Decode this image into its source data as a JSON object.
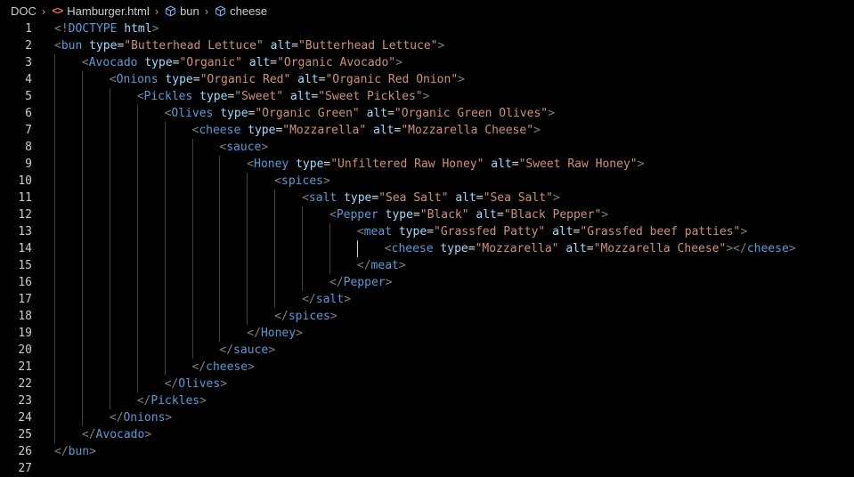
{
  "breadcrumb": [
    {
      "label": "DOC",
      "icon": null
    },
    {
      "label": "Hamburger.html",
      "icon": "html-file-icon"
    },
    {
      "label": "bun",
      "icon": "element-cube-icon"
    },
    {
      "label": "cheese",
      "icon": "element-cube-icon"
    }
  ],
  "colors": {
    "background": "#000000",
    "tag": "#569cd6",
    "attribute": "#9cdcfe",
    "string": "#ce9178",
    "punctuation": "#808080",
    "line_number": "#cccccc",
    "html_icon": "#e37933",
    "cube_icon": "#75beff"
  },
  "lines": [
    {
      "n": "1",
      "depth": 0,
      "tokens": [
        [
          "p",
          "<!"
        ],
        [
          "t",
          "DOCTYPE"
        ],
        [
          "k",
          " "
        ],
        [
          "a",
          "html"
        ],
        [
          "p",
          ">"
        ]
      ]
    },
    {
      "n": "2",
      "depth": 0,
      "tokens": [
        [
          "p",
          "<"
        ],
        [
          "t",
          "bun"
        ],
        [
          "k",
          " "
        ],
        [
          "a",
          "type"
        ],
        [
          "k",
          "="
        ],
        [
          "s",
          "\"Butterhead Lettuce\""
        ],
        [
          "k",
          " "
        ],
        [
          "a",
          "alt"
        ],
        [
          "k",
          "="
        ],
        [
          "s",
          "\"Butterhead Lettuce\""
        ],
        [
          "p",
          ">"
        ]
      ]
    },
    {
      "n": "3",
      "depth": 1,
      "tokens": [
        [
          "p",
          "<"
        ],
        [
          "t",
          "Avocado"
        ],
        [
          "k",
          " "
        ],
        [
          "a",
          "type"
        ],
        [
          "k",
          "="
        ],
        [
          "s",
          "\"Organic\""
        ],
        [
          "k",
          " "
        ],
        [
          "a",
          "alt"
        ],
        [
          "k",
          "="
        ],
        [
          "s",
          "\"Organic Avocado\""
        ],
        [
          "p",
          ">"
        ]
      ]
    },
    {
      "n": "4",
      "depth": 2,
      "tokens": [
        [
          "p",
          "<"
        ],
        [
          "t",
          "Onions"
        ],
        [
          "k",
          " "
        ],
        [
          "a",
          "type"
        ],
        [
          "k",
          "="
        ],
        [
          "s",
          "\"Organic Red\""
        ],
        [
          "k",
          " "
        ],
        [
          "a",
          "alt"
        ],
        [
          "k",
          "="
        ],
        [
          "s",
          "\"Organic Red Onion\""
        ],
        [
          "p",
          ">"
        ]
      ]
    },
    {
      "n": "5",
      "depth": 3,
      "tokens": [
        [
          "p",
          "<"
        ],
        [
          "t",
          "Pickles"
        ],
        [
          "k",
          " "
        ],
        [
          "a",
          "type"
        ],
        [
          "k",
          "="
        ],
        [
          "s",
          "\"Sweet\""
        ],
        [
          "k",
          " "
        ],
        [
          "a",
          "alt"
        ],
        [
          "k",
          "="
        ],
        [
          "s",
          "\"Sweet Pickles\""
        ],
        [
          "p",
          ">"
        ]
      ]
    },
    {
      "n": "6",
      "depth": 4,
      "tokens": [
        [
          "p",
          "<"
        ],
        [
          "t",
          "Olives"
        ],
        [
          "k",
          " "
        ],
        [
          "a",
          "type"
        ],
        [
          "k",
          "="
        ],
        [
          "s",
          "\"Organic Green\""
        ],
        [
          "k",
          " "
        ],
        [
          "a",
          "alt"
        ],
        [
          "k",
          "="
        ],
        [
          "s",
          "\"Organic Green Olives\""
        ],
        [
          "p",
          ">"
        ]
      ]
    },
    {
      "n": "7",
      "depth": 5,
      "tokens": [
        [
          "p",
          "<"
        ],
        [
          "t",
          "cheese"
        ],
        [
          "k",
          " "
        ],
        [
          "a",
          "type"
        ],
        [
          "k",
          "="
        ],
        [
          "s",
          "\"Mozzarella\""
        ],
        [
          "k",
          " "
        ],
        [
          "a",
          "alt"
        ],
        [
          "k",
          "="
        ],
        [
          "s",
          "\"Mozzarella Cheese\""
        ],
        [
          "p",
          ">"
        ]
      ]
    },
    {
      "n": "8",
      "depth": 6,
      "tokens": [
        [
          "p",
          "<"
        ],
        [
          "t",
          "sauce"
        ],
        [
          "p",
          ">"
        ]
      ]
    },
    {
      "n": "9",
      "depth": 7,
      "tokens": [
        [
          "p",
          "<"
        ],
        [
          "t",
          "Honey"
        ],
        [
          "k",
          " "
        ],
        [
          "a",
          "type"
        ],
        [
          "k",
          "="
        ],
        [
          "s",
          "\"Unfiltered Raw Honey\""
        ],
        [
          "k",
          " "
        ],
        [
          "a",
          "alt"
        ],
        [
          "k",
          "="
        ],
        [
          "s",
          "\"Sweet Raw Honey\""
        ],
        [
          "p",
          ">"
        ]
      ]
    },
    {
      "n": "10",
      "depth": 8,
      "tokens": [
        [
          "p",
          "<"
        ],
        [
          "t",
          "spices"
        ],
        [
          "p",
          ">"
        ]
      ]
    },
    {
      "n": "11",
      "depth": 9,
      "tokens": [
        [
          "p",
          "<"
        ],
        [
          "t",
          "salt"
        ],
        [
          "k",
          " "
        ],
        [
          "a",
          "type"
        ],
        [
          "k",
          "="
        ],
        [
          "s",
          "\"Sea Salt\""
        ],
        [
          "k",
          " "
        ],
        [
          "a",
          "alt"
        ],
        [
          "k",
          "="
        ],
        [
          "s",
          "\"Sea Salt\""
        ],
        [
          "p",
          ">"
        ]
      ]
    },
    {
      "n": "12",
      "depth": 10,
      "tokens": [
        [
          "p",
          "<"
        ],
        [
          "t",
          "Pepper"
        ],
        [
          "k",
          " "
        ],
        [
          "a",
          "type"
        ],
        [
          "k",
          "="
        ],
        [
          "s",
          "\"Black\""
        ],
        [
          "k",
          " "
        ],
        [
          "a",
          "alt"
        ],
        [
          "k",
          "="
        ],
        [
          "s",
          "\"Black Pepper\""
        ],
        [
          "p",
          ">"
        ]
      ]
    },
    {
      "n": "13",
      "depth": 11,
      "tokens": [
        [
          "p",
          "<"
        ],
        [
          "t",
          "meat"
        ],
        [
          "k",
          " "
        ],
        [
          "a",
          "type"
        ],
        [
          "k",
          "="
        ],
        [
          "s",
          "\"Grassfed Patty\""
        ],
        [
          "k",
          " "
        ],
        [
          "a",
          "alt"
        ],
        [
          "k",
          "="
        ],
        [
          "s",
          "\"Grassfed beef patties\""
        ],
        [
          "p",
          ">"
        ]
      ]
    },
    {
      "n": "14",
      "depth": 12,
      "tokens": [
        [
          "p",
          "<"
        ],
        [
          "t",
          "cheese"
        ],
        [
          "k",
          " "
        ],
        [
          "a",
          "type"
        ],
        [
          "k",
          "="
        ],
        [
          "s",
          "\"Mozzarella\""
        ],
        [
          "k",
          " "
        ],
        [
          "a",
          "alt"
        ],
        [
          "k",
          "="
        ],
        [
          "s",
          "\"Mozzarella Cheese\""
        ],
        [
          "p",
          "></"
        ],
        [
          "t",
          "cheese"
        ],
        [
          "p",
          ">"
        ]
      ]
    },
    {
      "n": "15",
      "depth": 11,
      "tokens": [
        [
          "p",
          "</"
        ],
        [
          "t",
          "meat"
        ],
        [
          "p",
          ">"
        ]
      ]
    },
    {
      "n": "16",
      "depth": 10,
      "tokens": [
        [
          "p",
          "</"
        ],
        [
          "t",
          "Pepper"
        ],
        [
          "p",
          ">"
        ]
      ]
    },
    {
      "n": "17",
      "depth": 9,
      "tokens": [
        [
          "p",
          "</"
        ],
        [
          "t",
          "salt"
        ],
        [
          "p",
          ">"
        ]
      ]
    },
    {
      "n": "18",
      "depth": 8,
      "tokens": [
        [
          "p",
          "</"
        ],
        [
          "t",
          "spices"
        ],
        [
          "p",
          ">"
        ]
      ]
    },
    {
      "n": "19",
      "depth": 7,
      "tokens": [
        [
          "p",
          "</"
        ],
        [
          "t",
          "Honey"
        ],
        [
          "p",
          ">"
        ]
      ]
    },
    {
      "n": "20",
      "depth": 6,
      "tokens": [
        [
          "p",
          "</"
        ],
        [
          "t",
          "sauce"
        ],
        [
          "p",
          ">"
        ]
      ]
    },
    {
      "n": "21",
      "depth": 5,
      "tokens": [
        [
          "p",
          "</"
        ],
        [
          "t",
          "cheese"
        ],
        [
          "p",
          ">"
        ]
      ]
    },
    {
      "n": "22",
      "depth": 4,
      "tokens": [
        [
          "p",
          "</"
        ],
        [
          "t",
          "Olives"
        ],
        [
          "p",
          ">"
        ]
      ]
    },
    {
      "n": "23",
      "depth": 3,
      "tokens": [
        [
          "p",
          "</"
        ],
        [
          "t",
          "Pickles"
        ],
        [
          "p",
          ">"
        ]
      ]
    },
    {
      "n": "24",
      "depth": 2,
      "tokens": [
        [
          "p",
          "</"
        ],
        [
          "t",
          "Onions"
        ],
        [
          "p",
          ">"
        ]
      ]
    },
    {
      "n": "25",
      "depth": 1,
      "tokens": [
        [
          "p",
          "</"
        ],
        [
          "t",
          "Avocado"
        ],
        [
          "p",
          ">"
        ]
      ]
    },
    {
      "n": "26",
      "depth": 0,
      "tokens": [
        [
          "p",
          "</"
        ],
        [
          "t",
          "bun"
        ],
        [
          "p",
          ">"
        ]
      ]
    },
    {
      "n": "27",
      "depth": 0,
      "tokens": []
    }
  ]
}
